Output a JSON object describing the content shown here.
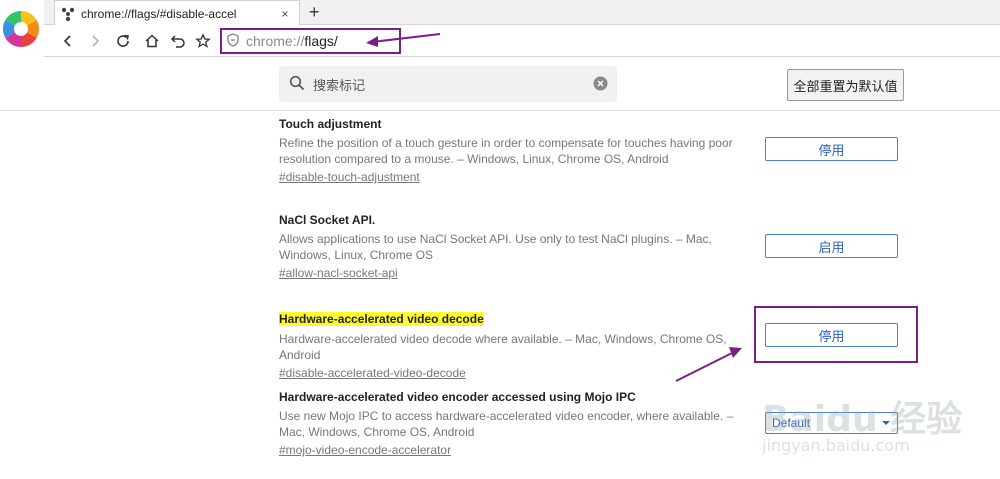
{
  "browser": {
    "tab_title": "chrome://flags/#disable-accel",
    "tab_close": "×",
    "new_tab": "+",
    "url_scheme": "chrome://",
    "url_host": "flags/"
  },
  "header": {
    "search_placeholder": "搜索标记",
    "reset_label": "全部重置为默认值"
  },
  "experiments": [
    {
      "name": "Touch adjustment",
      "description": "Refine the position of a touch gesture in order to compensate for touches having poor resolution compared to a mouse.  – Windows, Linux, Chrome OS, Android",
      "link": "#disable-touch-adjustment",
      "control": "停用"
    },
    {
      "name": "NaCl Socket API.",
      "description": "Allows applications to use NaCl Socket API. Use only to test NaCl plugins.  – Mac, Windows, Linux, Chrome OS",
      "link": "#allow-nacl-socket-api",
      "control": "启用"
    },
    {
      "name": "Hardware-accelerated video decode",
      "description": "Hardware-accelerated video decode where available.  – Mac, Windows, Chrome OS, Android",
      "link": "#disable-accelerated-video-decode",
      "control": "停用"
    },
    {
      "name": "Hardware-accelerated video encoder accessed using Mojo IPC",
      "description": "Use new Mojo IPC to access hardware-accelerated video encoder, where available.  – Mac, Windows, Chrome OS, Android",
      "link": "#mojo-video-encode-accelerator",
      "control": "Default"
    }
  ],
  "watermark": {
    "brand": "Baidu 经验",
    "sub": "jingyan.baidu.com"
  },
  "colors": {
    "highlight_box": "#7b1f86",
    "control_blue": "#4a7fd2",
    "highlight_text": "#fffb2c"
  },
  "icons": [
    "browser-logo-icon",
    "flask-icon",
    "back-icon",
    "forward-icon",
    "reload-icon",
    "home-icon",
    "undo-icon",
    "bookmark-star-icon",
    "shield-icon",
    "search-icon",
    "clear-icon",
    "dropdown-arrow-icon"
  ]
}
